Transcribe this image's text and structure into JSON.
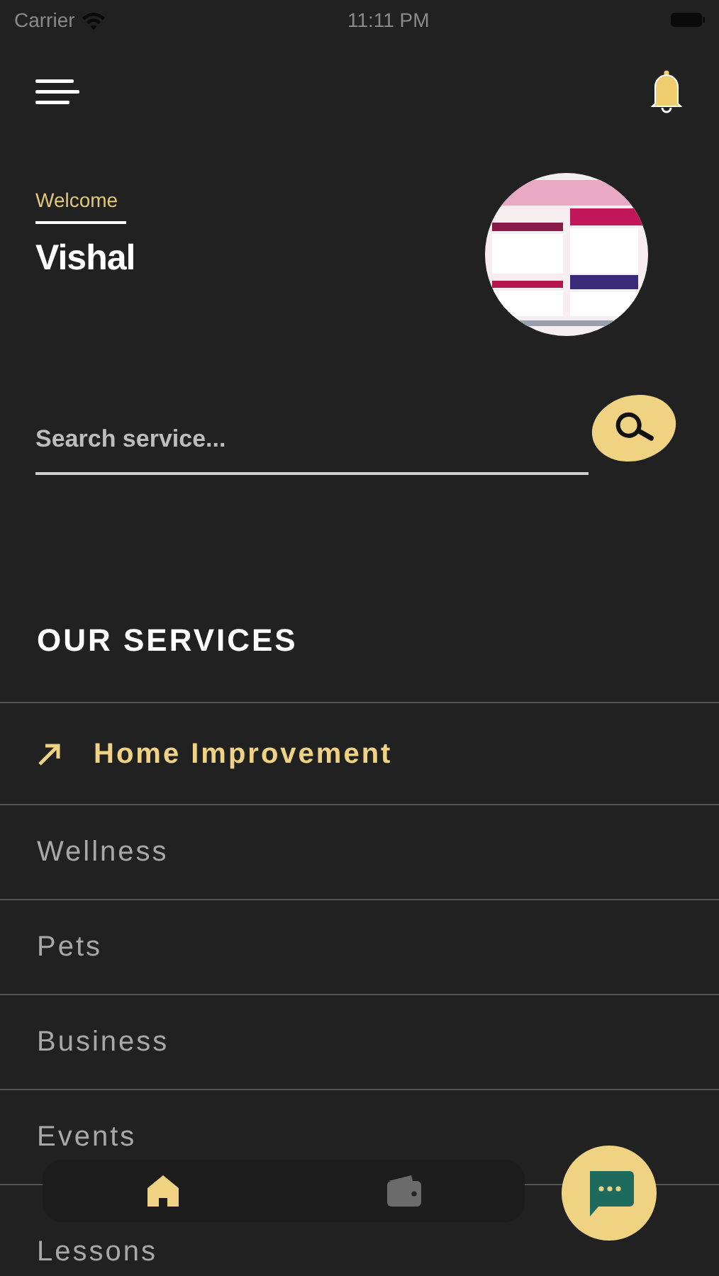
{
  "status_bar": {
    "carrier": "Carrier",
    "time": "11:11 PM"
  },
  "greeting": {
    "welcome": "Welcome",
    "name": "Vishal"
  },
  "search": {
    "placeholder": "Search service..."
  },
  "services": {
    "title": "OUR SERVICES",
    "items": [
      {
        "label": "Home Improvement",
        "selected": true
      },
      {
        "label": "Wellness",
        "selected": false
      },
      {
        "label": "Pets",
        "selected": false
      },
      {
        "label": "Business",
        "selected": false
      },
      {
        "label": "Events",
        "selected": false
      },
      {
        "label": "Lessons",
        "selected": false
      }
    ]
  },
  "tab_bar": [
    {
      "kind": "home",
      "selected": true
    },
    {
      "kind": "wallet",
      "selected": false
    }
  ]
}
